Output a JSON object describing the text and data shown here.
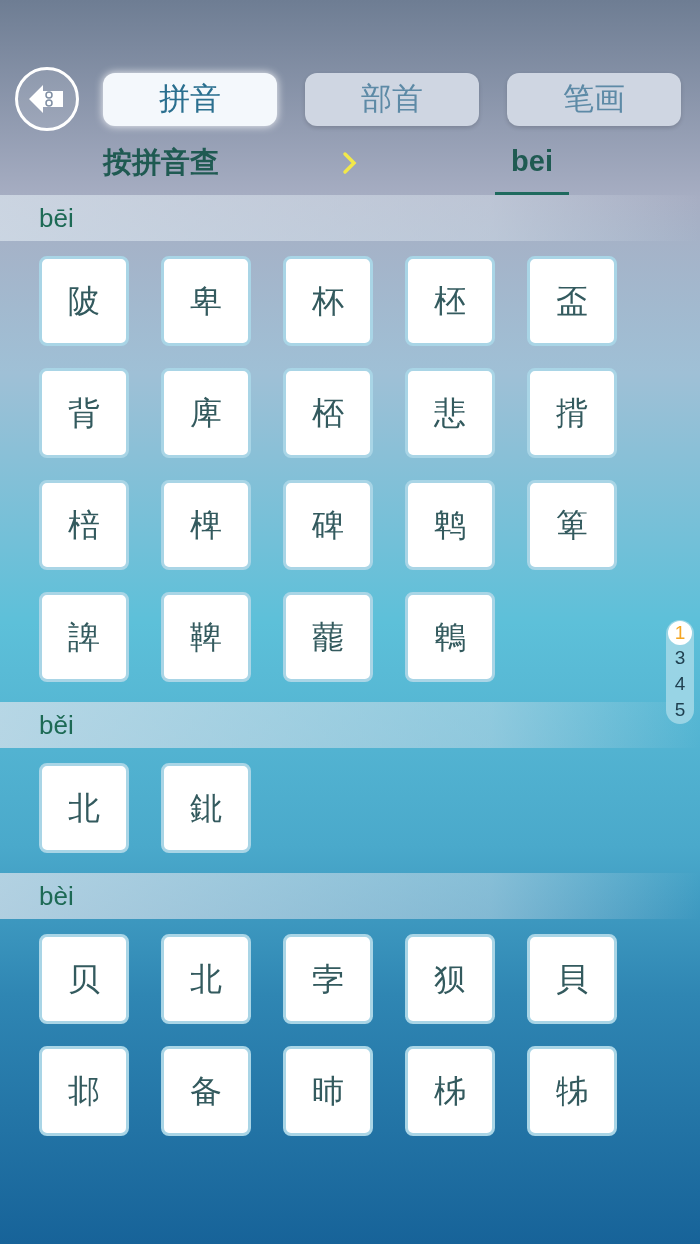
{
  "tabs": [
    {
      "label": "拼音",
      "selected": true
    },
    {
      "label": "部首",
      "selected": false
    },
    {
      "label": "笔画",
      "selected": false
    }
  ],
  "breadcrumb": {
    "mode": "按拼音查",
    "current": "bei"
  },
  "sections": [
    {
      "pinyin": "bēi",
      "characters": [
        "陂",
        "卑",
        "杯",
        "柸",
        "盃",
        "背",
        "庳",
        "桮",
        "悲",
        "揹",
        "棓",
        "椑",
        "碑",
        "鹎",
        "箄",
        "諀",
        "鞞",
        "藣",
        "鵯"
      ]
    },
    {
      "pinyin": "běi",
      "characters": [
        "北",
        "鉳"
      ]
    },
    {
      "pinyin": "bèi",
      "characters": [
        "贝",
        "北",
        "孛",
        "狈",
        "貝",
        "邶",
        "备",
        "昁",
        "柹",
        "牬"
      ]
    }
  ],
  "index": [
    {
      "label": "1",
      "selected": true
    },
    {
      "label": "3",
      "selected": false
    },
    {
      "label": "4",
      "selected": false
    },
    {
      "label": "5",
      "selected": false
    }
  ]
}
